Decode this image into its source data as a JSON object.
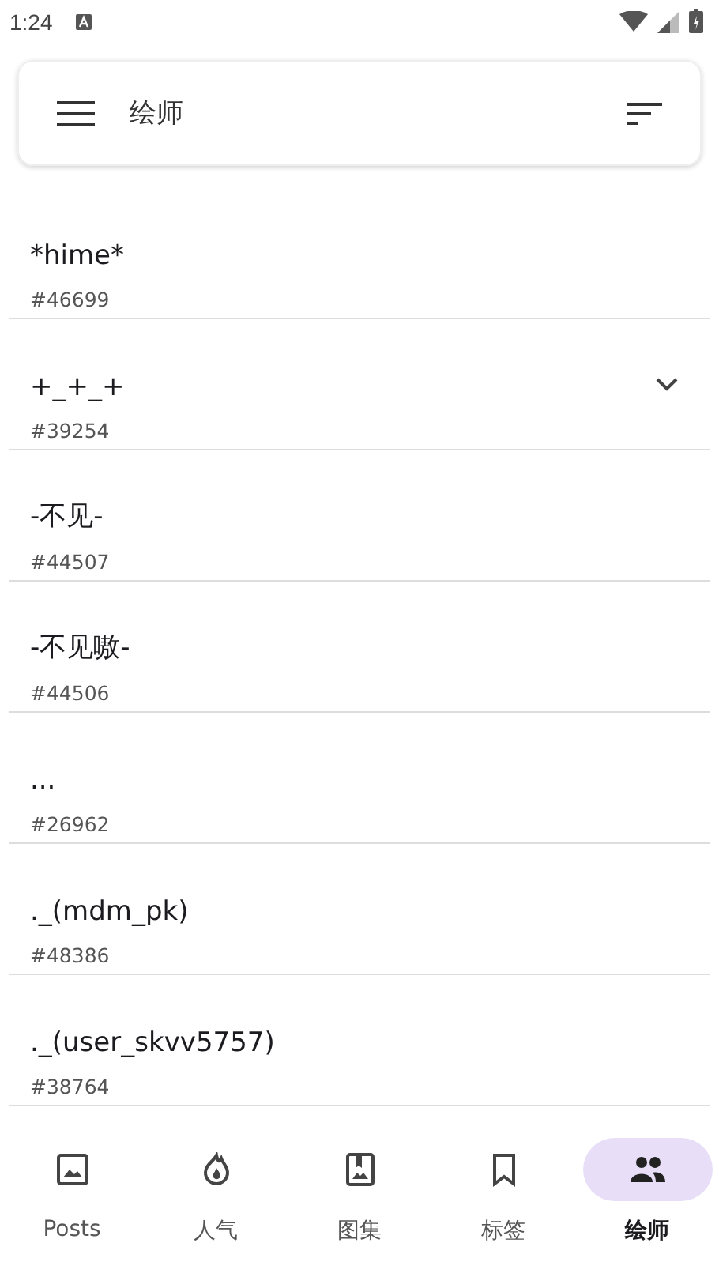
{
  "status_bar": {
    "time": "1:24"
  },
  "search_bar": {
    "title": "绘师"
  },
  "artists": [
    {
      "name": "*hime*",
      "id": "#46699",
      "expandable": false
    },
    {
      "name": "+_+_+",
      "id": "#39254",
      "expandable": true
    },
    {
      "name": "-不见-",
      "id": "#44507",
      "expandable": false
    },
    {
      "name": "-不见嗷-",
      "id": "#44506",
      "expandable": false
    },
    {
      "name": "...",
      "id": "#26962",
      "expandable": false
    },
    {
      "name": "._(mdm_pk)",
      "id": "#48386",
      "expandable": false
    },
    {
      "name": "._(user_skvv5757)",
      "id": "#38764",
      "expandable": false
    }
  ],
  "bottom_nav": [
    {
      "label": "Posts",
      "kind": "image",
      "selected": false
    },
    {
      "label": "人气",
      "kind": "fire",
      "selected": false
    },
    {
      "label": "图集",
      "kind": "album",
      "selected": false
    },
    {
      "label": "标签",
      "kind": "bookmark",
      "selected": false
    },
    {
      "label": "绘师",
      "kind": "people",
      "selected": true
    }
  ]
}
